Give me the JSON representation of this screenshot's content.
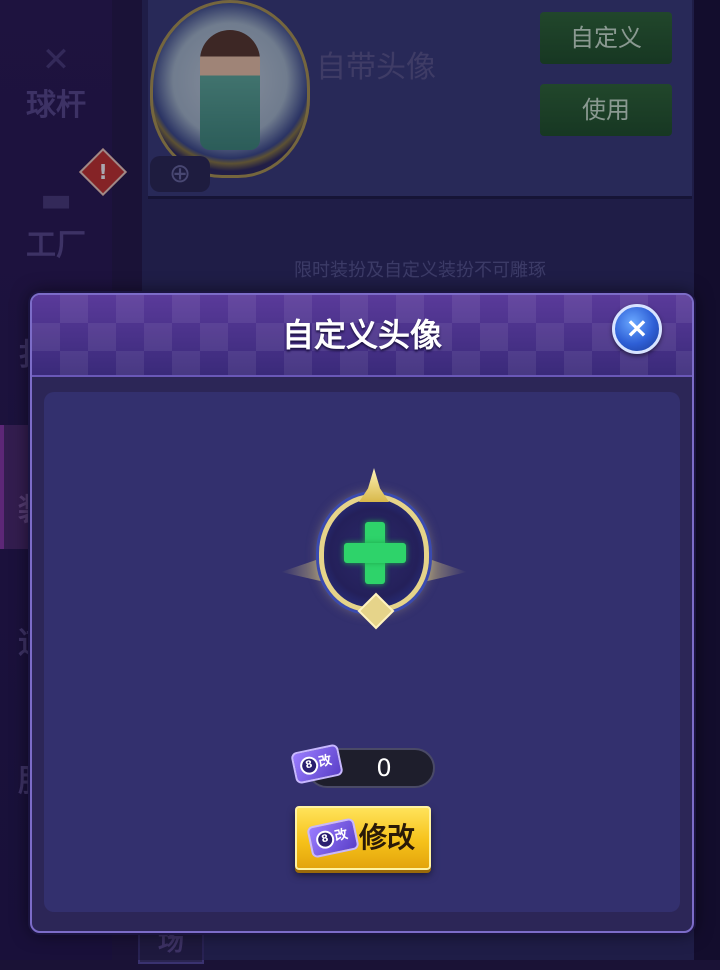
{
  "background": {
    "sidebar_items": [
      {
        "label": "球杆",
        "icon": "cue-icon"
      },
      {
        "label": "工厂",
        "icon": "factory-icon"
      },
      {
        "label": "扌",
        "icon": "item-icon"
      },
      {
        "label": "装",
        "icon": "dress-icon"
      },
      {
        "label": "道",
        "icon": "prop-icon"
      },
      {
        "label": "服",
        "icon": "clothes-icon"
      }
    ],
    "avatar_title": "自带头像",
    "custom_button": "自定义",
    "use_button": "使用",
    "note": "限时装扮及自定义装扮不可雕琢",
    "bottom_tab": "场",
    "warning_mark": "!"
  },
  "modal": {
    "title": "自定义头像",
    "close_icon": "×",
    "ticket_count": "0",
    "ticket_ball": "8",
    "ticket_mark": "改",
    "modify_button": "修改"
  },
  "colors": {
    "modal_bg": "#2c2657",
    "body_bg": "#33306e",
    "plus_green": "#2ed36a",
    "button_gold": "#f6c21a",
    "close_blue": "#2e5fd6"
  }
}
